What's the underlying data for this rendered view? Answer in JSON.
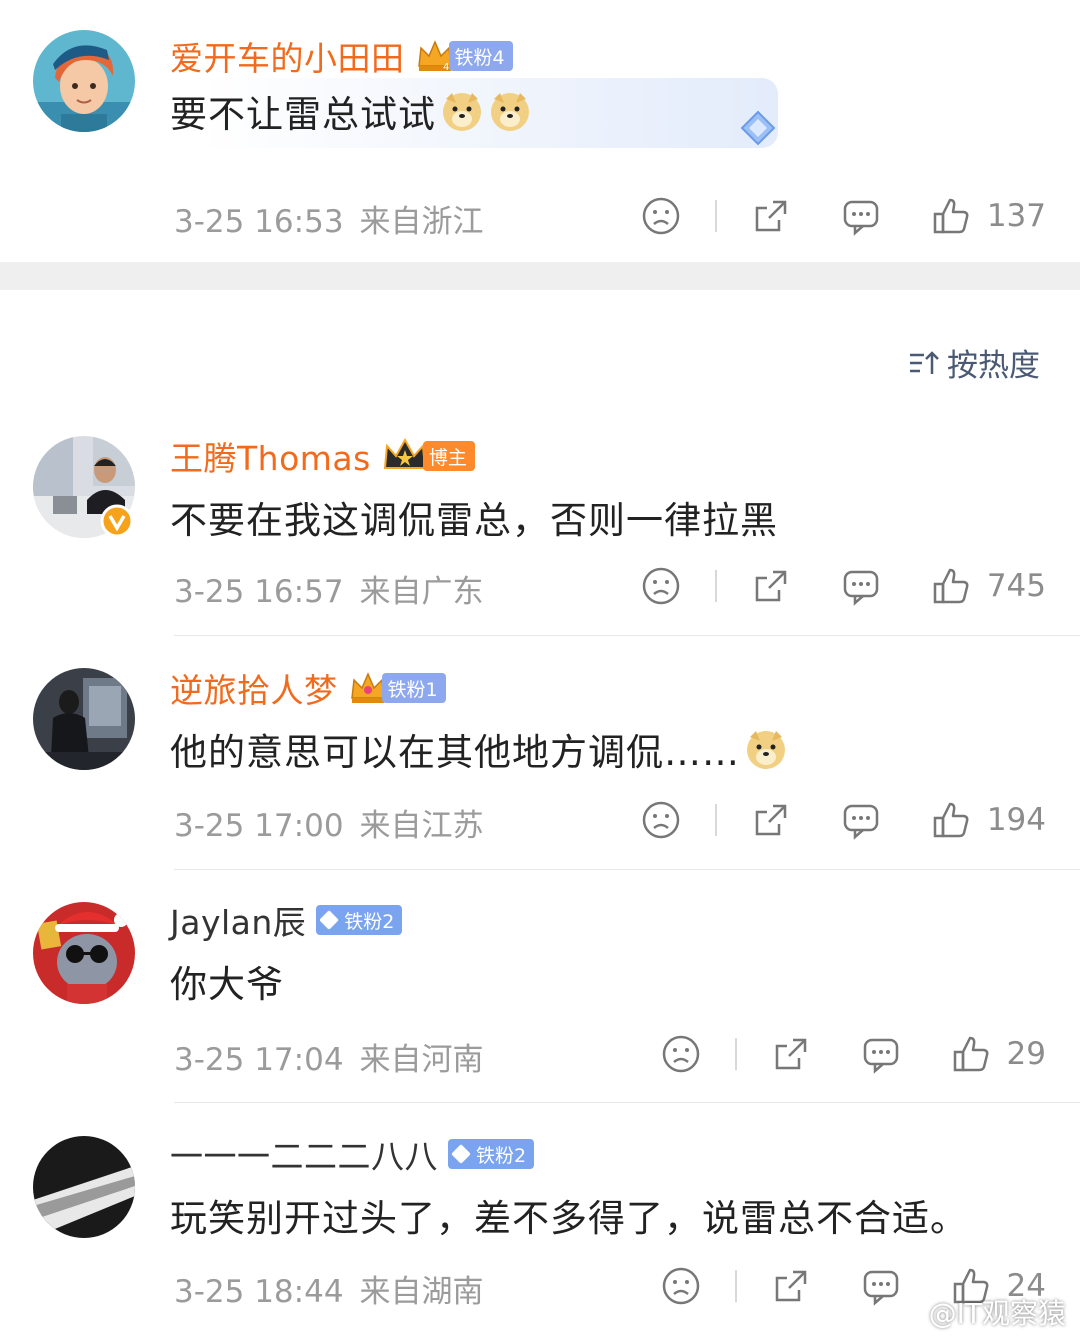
{
  "comments": [
    {
      "name": "爱开车的小田田",
      "badge": "铁粉4",
      "text": "要不让雷总试试",
      "time": "3-25 16:53",
      "location": "来自浙江",
      "likes": "137"
    },
    {
      "name": "王腾Thomas",
      "badge": "博主",
      "text": "不要在我这调侃雷总，否则一律拉黑",
      "time": "3-25 16:57",
      "location": "来自广东",
      "likes": "745"
    },
    {
      "name": "逆旅拾人梦",
      "badge": "铁粉1",
      "text": "他的意思可以在其他地方调侃……",
      "time": "3-25 17:00",
      "location": "来自江苏",
      "likes": "194"
    },
    {
      "name": "Jaylan辰",
      "badge": "铁粉2",
      "text": "你大爷",
      "time": "3-25 17:04",
      "location": "来自河南",
      "likes": "29"
    },
    {
      "name": "一一一二二二八八",
      "badge": "铁粉2",
      "text": "玩笑别开过头了，差不多得了，说雷总不合适。",
      "time": "3-25 18:44",
      "location": "来自湖南",
      "likes": "24"
    }
  ],
  "sort": {
    "label": "按热度",
    "icon": "sort-icon"
  },
  "watermark": "@IT观察猿",
  "colors": {
    "vip_name": "#f26a1b",
    "badge_blue": "#8da8ee",
    "badge_orange": "#ff8a2b",
    "meta_gray": "#9b9b9b"
  }
}
